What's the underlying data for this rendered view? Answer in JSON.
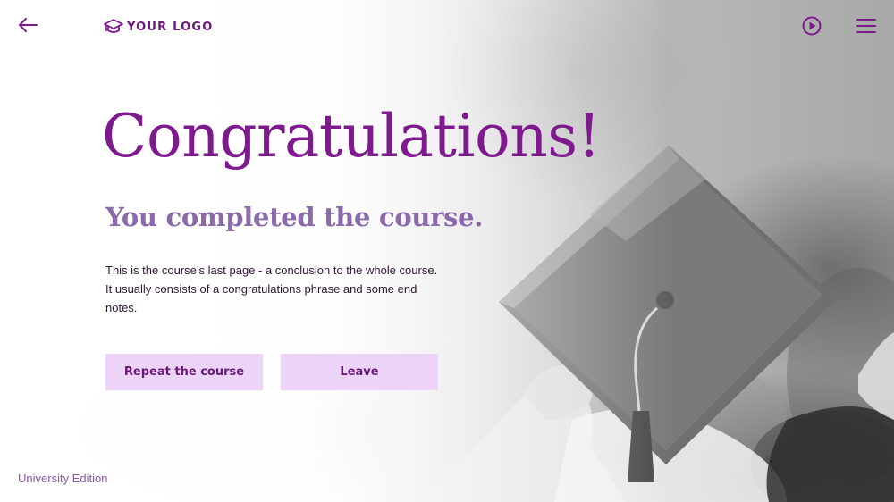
{
  "header": {
    "back_icon": "arrow-left-icon",
    "logo_icon": "graduation-cap-icon",
    "logo_text": "YOUR LOGO",
    "play_icon": "play-circle-icon",
    "menu_icon": "hamburger-menu-icon"
  },
  "main": {
    "title": "Congratulations!",
    "subtitle": "You completed the course.",
    "body": "This is the course’s last page - a conclusion to the whole course. It usually consists of a congratulations phrase and some end notes.",
    "buttons": {
      "repeat_label": "Repeat the course",
      "leave_label": "Leave"
    }
  },
  "footer": {
    "edition": "University Edition"
  },
  "colors": {
    "accent": "#7e1a8e",
    "subtitle": "#8a6aa8",
    "button_bg": "#ecd3f8",
    "button_text": "#6a1877"
  }
}
